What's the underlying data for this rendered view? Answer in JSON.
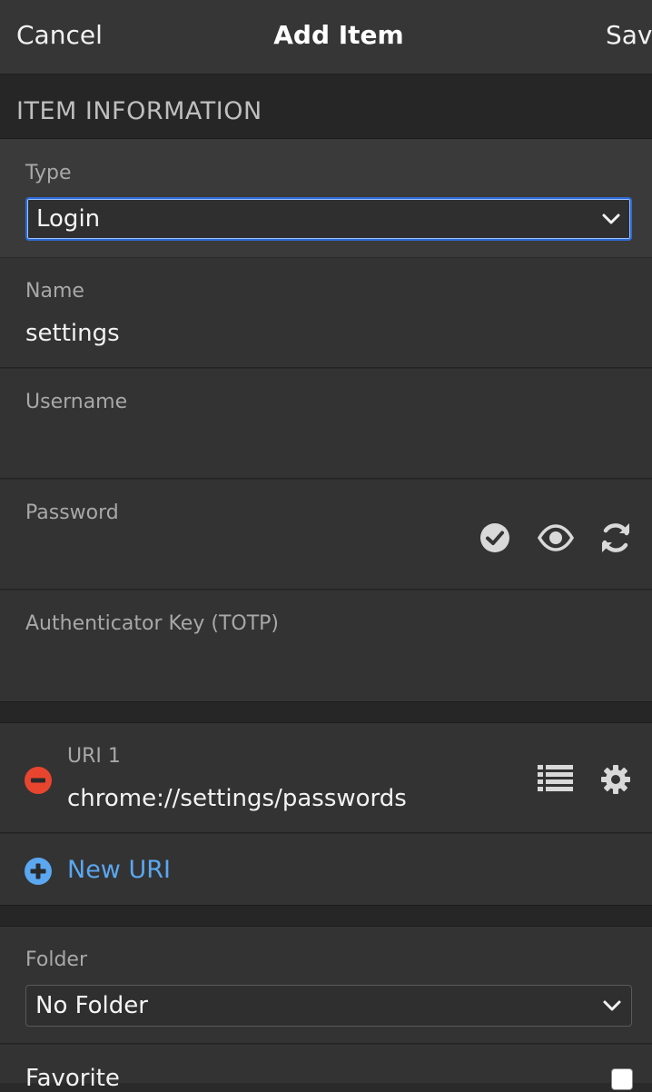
{
  "header": {
    "cancel": "Cancel",
    "title": "Add Item",
    "save": "Save"
  },
  "section": {
    "item_information": "ITEM INFORMATION"
  },
  "type": {
    "label": "Type",
    "value": "Login"
  },
  "name": {
    "label": "Name",
    "value": "settings"
  },
  "username": {
    "label": "Username",
    "value": ""
  },
  "password": {
    "label": "Password",
    "value": ""
  },
  "totp": {
    "label": "Authenticator Key (TOTP)",
    "value": ""
  },
  "uri": {
    "label": "URI 1",
    "value": "chrome://settings/passwords"
  },
  "new_uri": {
    "label": "New URI"
  },
  "folder": {
    "label": "Folder",
    "value": "No Folder"
  },
  "favorite": {
    "label": "Favorite",
    "checked": false
  },
  "colors": {
    "background": "#2a2a2a",
    "row": "#333333",
    "focus_border": "#2f6bd6",
    "remove": "#e8452f",
    "link": "#5ba7f0"
  }
}
